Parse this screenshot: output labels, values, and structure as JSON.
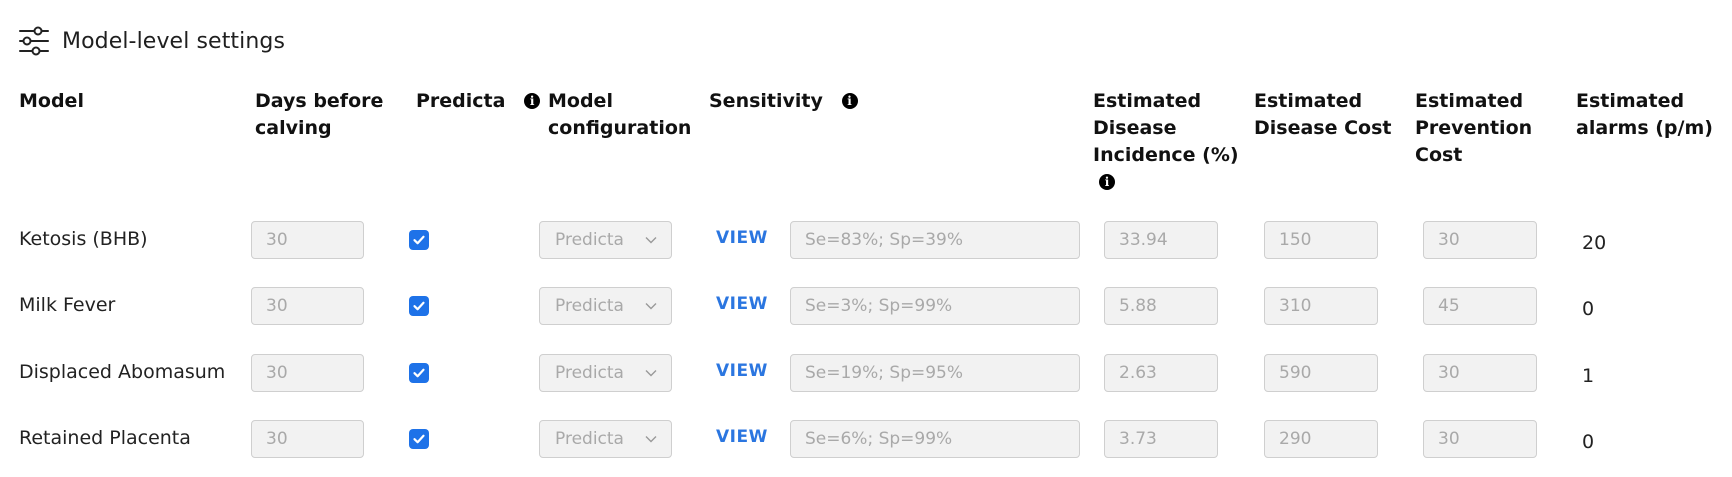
{
  "title": "Model-level settings",
  "icons": {
    "settings": "sliders-icon",
    "info": "info-icon",
    "checkbox": "check-icon",
    "dropdown": "chevron-down-icon"
  },
  "colors": {
    "accent": "#1e72e8",
    "link": "#2b76e0",
    "field_bg": "#f2f2f2"
  },
  "headers": {
    "model": "Model",
    "days_line1": "Days before",
    "days_line2": "calving",
    "predicta": "Predicta",
    "config_line1": "Model",
    "config_line2": "configuration",
    "sensitivity": "Sensitivity",
    "incidence_line1": "Estimated",
    "incidence_line2": "Disease",
    "incidence_line3": "Incidence (%)",
    "disease_cost_line1": "Estimated",
    "disease_cost_line2": "Disease Cost",
    "prevention_line1": "Estimated",
    "prevention_line2": "Prevention",
    "prevention_line3": "Cost",
    "alarms_line1": "Estimated",
    "alarms_line2": "alarms (p/m)"
  },
  "info_glyph": "i",
  "rows": [
    {
      "model": "Ketosis (BHB)",
      "days": "30",
      "predicta_checked": true,
      "config": "Predicta",
      "view": "VIEW",
      "sensitivity": "Se=83%; Sp=39%",
      "incidence": "33.94",
      "disease_cost": "150",
      "prevention_cost": "30",
      "alarms": "20"
    },
    {
      "model": "Milk Fever",
      "days": "30",
      "predicta_checked": true,
      "config": "Predicta",
      "view": "VIEW",
      "sensitivity": "Se=3%; Sp=99%",
      "incidence": "5.88",
      "disease_cost": "310",
      "prevention_cost": "45",
      "alarms": "0"
    },
    {
      "model": "Displaced Abomasum",
      "days": "30",
      "predicta_checked": true,
      "config": "Predicta",
      "view": "VIEW",
      "sensitivity": "Se=19%; Sp=95%",
      "incidence": "2.63",
      "disease_cost": "590",
      "prevention_cost": "30",
      "alarms": "1"
    },
    {
      "model": "Retained Placenta",
      "days": "30",
      "predicta_checked": true,
      "config": "Predicta",
      "view": "VIEW",
      "sensitivity": "Se=6%; Sp=99%",
      "incidence": "3.73",
      "disease_cost": "290",
      "prevention_cost": "30",
      "alarms": "0"
    }
  ]
}
